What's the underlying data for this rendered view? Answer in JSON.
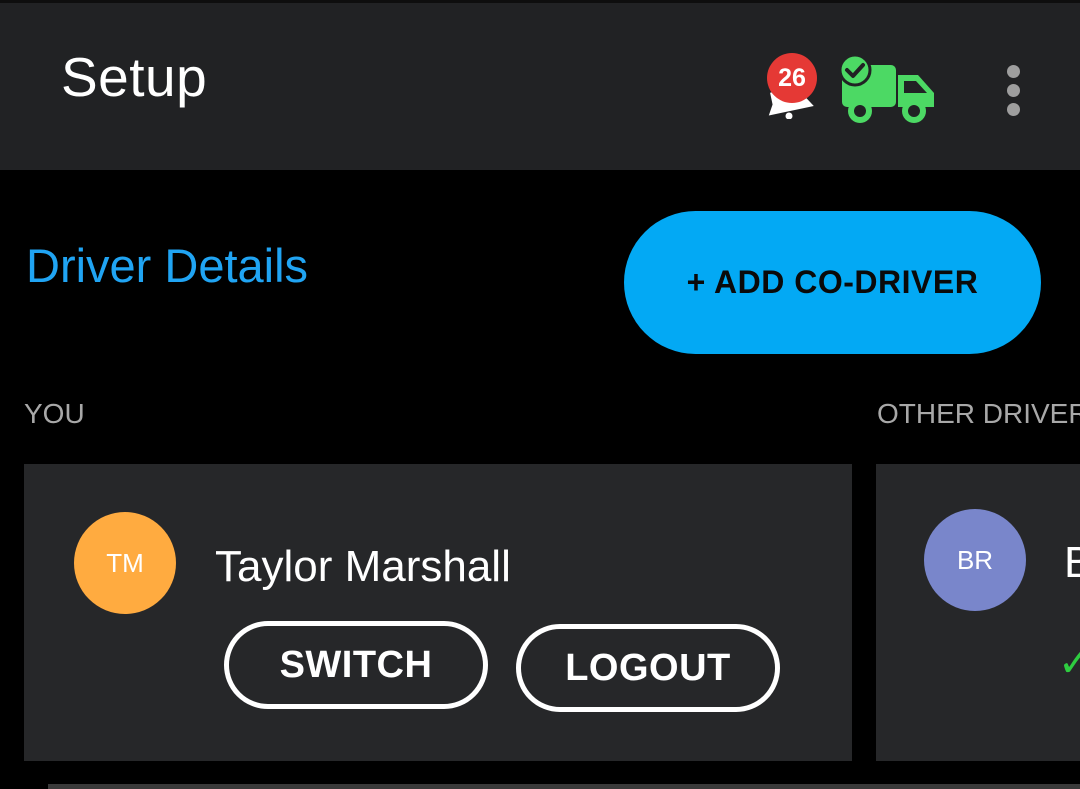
{
  "appbar": {
    "title": "Setup",
    "notification_count": "26",
    "icons": {
      "notification": "bell-icon",
      "truck": "truck-check-icon",
      "menu": "more-vert-icon"
    },
    "truck_color": "#4cd964"
  },
  "driver_details": {
    "title": "Driver Details",
    "add_button_label": "+ ADD CO-DRIVER"
  },
  "columns": {
    "you_label": "YOU",
    "other_label": "OTHER DRIVERS"
  },
  "current_driver": {
    "initials": "TM",
    "name": "Taylor Marshall",
    "avatar_color": "#ffab40",
    "switch_label": "SWITCH",
    "logout_label": "LOGOUT"
  },
  "other_driver": {
    "initials": "BR",
    "name_visible": "B",
    "avatar_color": "#7986cb",
    "status_glyph": "✓"
  }
}
